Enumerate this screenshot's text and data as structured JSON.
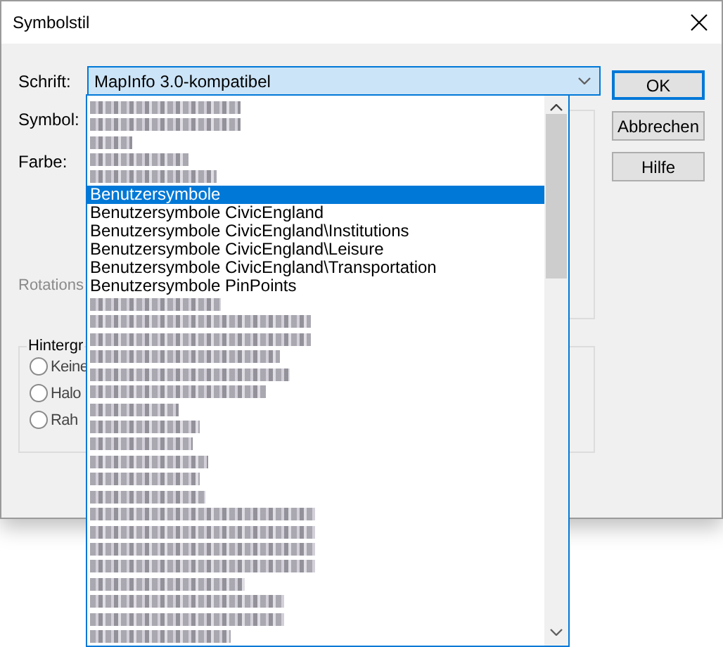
{
  "window": {
    "title": "Symbolstil"
  },
  "form": {
    "font_label": "Schrift:",
    "font_value": "MapInfo 3.0-kompatibel",
    "symbol_label": "Symbol:",
    "color_label": "Farbe:",
    "rotation_label": "Rotations",
    "rotation_disabled": true
  },
  "background_group": {
    "title": "Hintergr",
    "options": [
      {
        "label": "Keine",
        "selected": false
      },
      {
        "label": "Halo",
        "selected": false
      },
      {
        "label": "Rah",
        "selected": false
      }
    ]
  },
  "buttons": [
    {
      "label": "OK",
      "default": true
    },
    {
      "label": "Abbrechen",
      "default": false
    },
    {
      "label": "Hilfe",
      "default": false
    }
  ],
  "font_list": [
    {
      "kind": "redacted",
      "selected": false
    },
    {
      "kind": "redacted",
      "selected": false
    },
    {
      "kind": "redacted",
      "selected": false
    },
    {
      "kind": "redacted",
      "selected": false
    },
    {
      "kind": "redacted",
      "selected": false
    },
    {
      "kind": "text",
      "label": "Benutzersymbole",
      "selected": true
    },
    {
      "kind": "text",
      "label": "Benutzersymbole CivicEngland",
      "selected": false
    },
    {
      "kind": "text",
      "label": "Benutzersymbole CivicEngland\\Institutions",
      "selected": false
    },
    {
      "kind": "text",
      "label": "Benutzersymbole CivicEngland\\Leisure",
      "selected": false
    },
    {
      "kind": "text",
      "label": "Benutzersymbole CivicEngland\\Transportation",
      "selected": false
    },
    {
      "kind": "text",
      "label": "Benutzersymbole PinPoints",
      "selected": false
    },
    {
      "kind": "redacted",
      "selected": false
    },
    {
      "kind": "redacted",
      "selected": false
    },
    {
      "kind": "redacted",
      "selected": false
    },
    {
      "kind": "redacted",
      "selected": false
    },
    {
      "kind": "redacted",
      "selected": false
    },
    {
      "kind": "redacted",
      "selected": false
    },
    {
      "kind": "redacted",
      "selected": false
    },
    {
      "kind": "redacted",
      "selected": false
    },
    {
      "kind": "redacted",
      "selected": false
    },
    {
      "kind": "redacted",
      "selected": false
    },
    {
      "kind": "redacted",
      "selected": false
    },
    {
      "kind": "redacted",
      "selected": false
    },
    {
      "kind": "redacted",
      "selected": false
    },
    {
      "kind": "redacted",
      "selected": false
    },
    {
      "kind": "redacted",
      "selected": false
    },
    {
      "kind": "redacted",
      "selected": false
    },
    {
      "kind": "redacted",
      "selected": false
    },
    {
      "kind": "redacted",
      "selected": false
    },
    {
      "kind": "redacted",
      "selected": false
    },
    {
      "kind": "redacted",
      "selected": false
    }
  ]
}
